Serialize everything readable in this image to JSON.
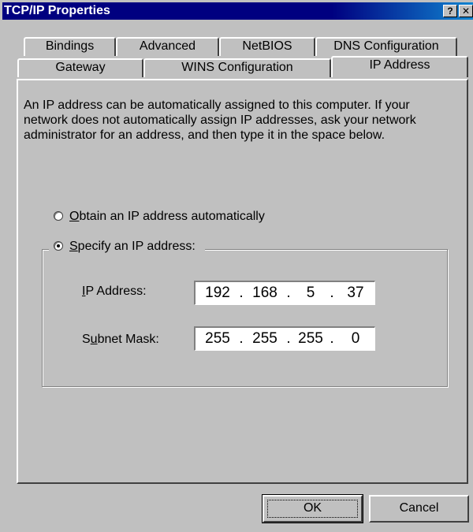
{
  "window": {
    "title": "TCP/IP Properties",
    "help_button": "?",
    "close_button": "✕"
  },
  "tabs": {
    "row1": [
      {
        "label": "Bindings"
      },
      {
        "label": "Advanced"
      },
      {
        "label": "NetBIOS"
      },
      {
        "label": "DNS Configuration"
      }
    ],
    "row2": [
      {
        "label": "Gateway"
      },
      {
        "label": "WINS Configuration"
      },
      {
        "label": "IP Address",
        "active": true
      }
    ]
  },
  "content": {
    "description": "An IP address can be automatically assigned to this computer. If your network does not automatically assign IP addresses, ask your network administrator for an address, and then type it in the space below.",
    "radio_auto": {
      "label_mnemonic": "O",
      "label_rest": "btain an IP address automatically",
      "selected": false
    },
    "radio_specify": {
      "label_mnemonic": "S",
      "label_rest": "pecify an IP address:",
      "selected": true
    },
    "ip_address": {
      "label_mnemonic": "I",
      "label_rest": "P Address:",
      "octets": [
        "192",
        "168",
        "5",
        "37"
      ]
    },
    "subnet_mask": {
      "label_pre": "S",
      "label_mnemonic": "u",
      "label_rest": "bnet Mask:",
      "octets": [
        "255",
        "255",
        "255",
        "0"
      ]
    },
    "separator": "."
  },
  "buttons": {
    "ok": "OK",
    "cancel": "Cancel"
  }
}
